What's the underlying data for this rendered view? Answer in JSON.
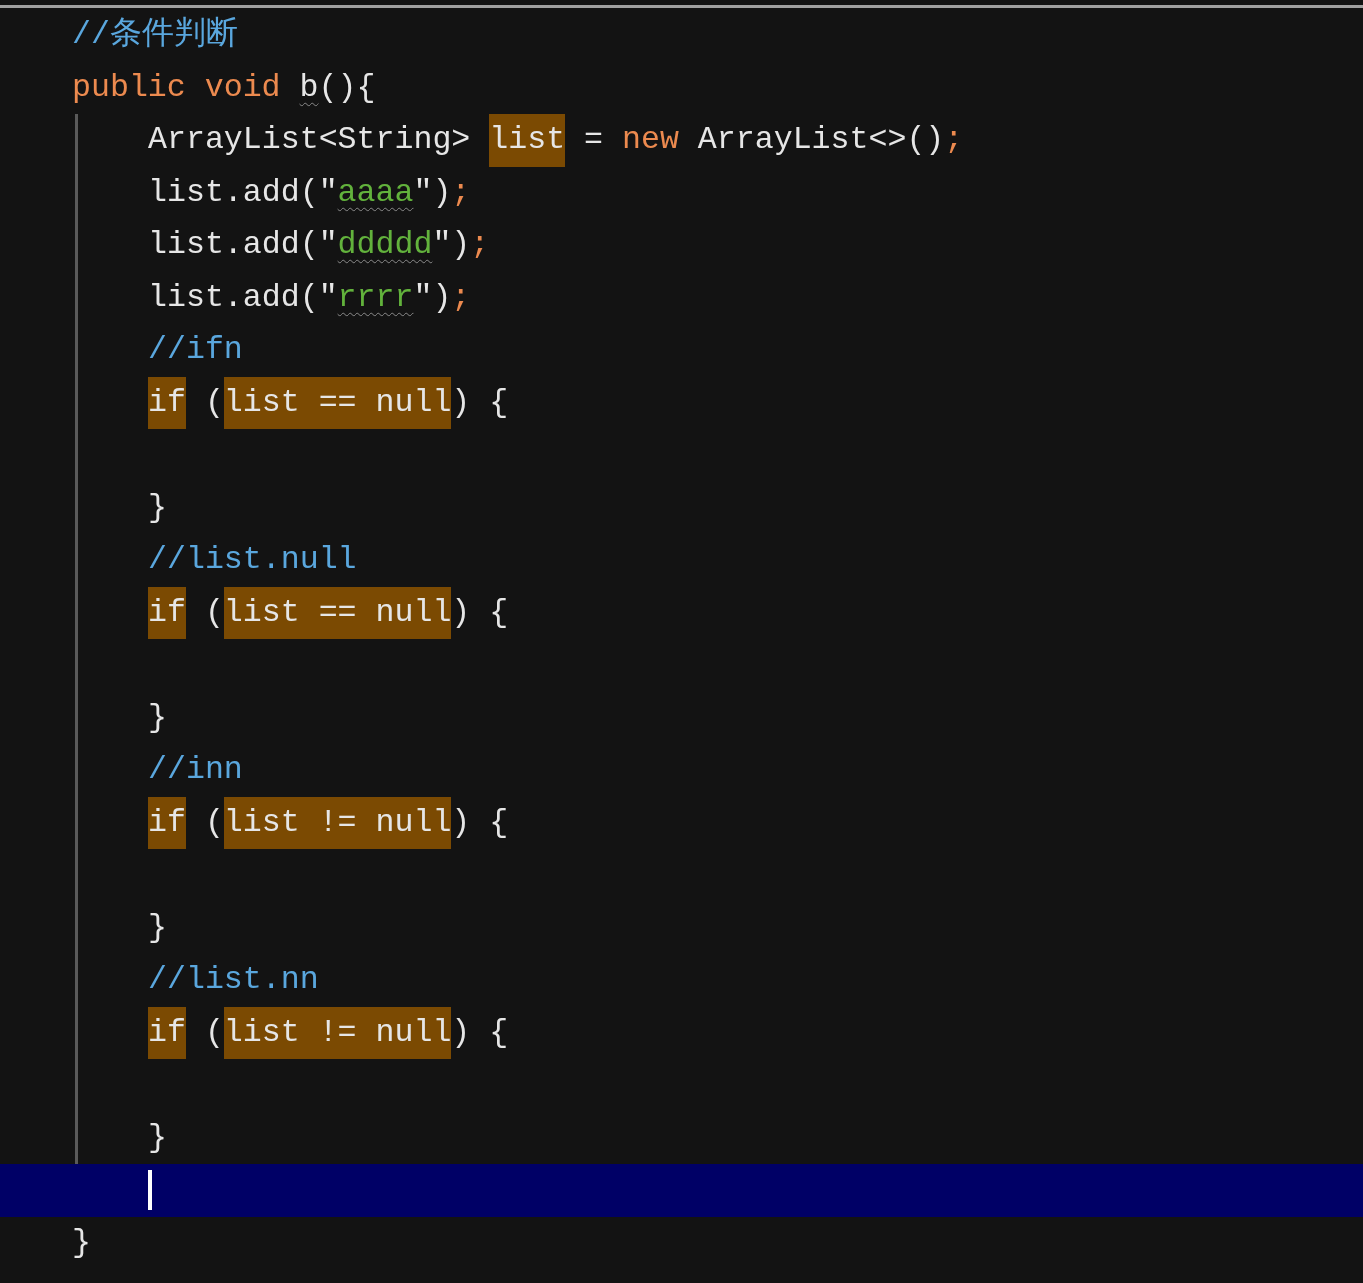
{
  "editor": {
    "lines": [
      {
        "kind": "code",
        "tokens": [
          {
            "text": "//条件判断",
            "kind": "comment"
          }
        ]
      },
      {
        "kind": "code",
        "tokens": [
          {
            "text": "public void ",
            "kind": "keyword"
          },
          {
            "text": "b",
            "kind": "text",
            "squiggle": true
          },
          {
            "text": "(){",
            "kind": "text"
          }
        ],
        "children": [
          {
            "kind": "code",
            "tokens": [
              {
                "text": "ArrayList<String> ",
                "kind": "text"
              },
              {
                "text": "list",
                "kind": "text",
                "highlighted": true
              },
              {
                "text": " = ",
                "kind": "text"
              },
              {
                "text": "new ",
                "kind": "keyword"
              },
              {
                "text": "ArrayList<>()",
                "kind": "text"
              },
              {
                "text": ";",
                "kind": "keyword"
              }
            ]
          },
          {
            "kind": "code",
            "tokens": [
              {
                "text": "list.add(\"",
                "kind": "text"
              },
              {
                "text": "aaaa",
                "kind": "string",
                "squiggle": true
              },
              {
                "text": "\")",
                "kind": "text"
              },
              {
                "text": ";",
                "kind": "keyword"
              }
            ]
          },
          {
            "kind": "code",
            "tokens": [
              {
                "text": "list.add(\"",
                "kind": "text"
              },
              {
                "text": "ddddd",
                "kind": "string",
                "squiggle": true
              },
              {
                "text": "\")",
                "kind": "text"
              },
              {
                "text": ";",
                "kind": "keyword"
              }
            ]
          },
          {
            "kind": "code",
            "tokens": [
              {
                "text": "list.add(\"",
                "kind": "text"
              },
              {
                "text": "rrrr",
                "kind": "string",
                "squiggle": true
              },
              {
                "text": "\")",
                "kind": "text"
              },
              {
                "text": ";",
                "kind": "keyword"
              }
            ]
          },
          {
            "kind": "code",
            "tokens": [
              {
                "text": "//ifn",
                "kind": "comment"
              }
            ]
          },
          {
            "kind": "code",
            "tokens": [
              {
                "text": "if",
                "kind": "text",
                "highlighted": true
              },
              {
                "text": " (",
                "kind": "text"
              },
              {
                "text": "list == null",
                "kind": "text",
                "highlighted": true
              },
              {
                "text": ") {",
                "kind": "text"
              }
            ]
          },
          {
            "kind": "blank"
          },
          {
            "kind": "code",
            "tokens": [
              {
                "text": "}",
                "kind": "text"
              }
            ]
          },
          {
            "kind": "code",
            "tokens": [
              {
                "text": "//list.null",
                "kind": "comment"
              }
            ]
          },
          {
            "kind": "code",
            "tokens": [
              {
                "text": "if",
                "kind": "text",
                "highlighted": true
              },
              {
                "text": " (",
                "kind": "text"
              },
              {
                "text": "list == null",
                "kind": "text",
                "highlighted": true
              },
              {
                "text": ") {",
                "kind": "text"
              }
            ]
          },
          {
            "kind": "blank"
          },
          {
            "kind": "code",
            "tokens": [
              {
                "text": "}",
                "kind": "text"
              }
            ]
          },
          {
            "kind": "code",
            "tokens": [
              {
                "text": "//inn",
                "kind": "comment"
              }
            ]
          },
          {
            "kind": "code",
            "tokens": [
              {
                "text": "if",
                "kind": "text",
                "highlighted": true
              },
              {
                "text": " (",
                "kind": "text"
              },
              {
                "text": "list != null",
                "kind": "text",
                "highlighted": true
              },
              {
                "text": ") {",
                "kind": "text"
              }
            ]
          },
          {
            "kind": "blank"
          },
          {
            "kind": "code",
            "tokens": [
              {
                "text": "}",
                "kind": "text"
              }
            ]
          },
          {
            "kind": "code",
            "tokens": [
              {
                "text": "//list.nn",
                "kind": "comment"
              }
            ]
          },
          {
            "kind": "code",
            "tokens": [
              {
                "text": "if",
                "kind": "text",
                "highlighted": true
              },
              {
                "text": " (",
                "kind": "text"
              },
              {
                "text": "list != null",
                "kind": "text",
                "highlighted": true
              },
              {
                "text": ") {",
                "kind": "text"
              }
            ]
          },
          {
            "kind": "blank"
          },
          {
            "kind": "code",
            "tokens": [
              {
                "text": "}",
                "kind": "text"
              }
            ]
          },
          {
            "kind": "caret"
          }
        ]
      },
      {
        "kind": "code",
        "tokens": [
          {
            "text": "}",
            "kind": "text"
          }
        ]
      }
    ]
  }
}
